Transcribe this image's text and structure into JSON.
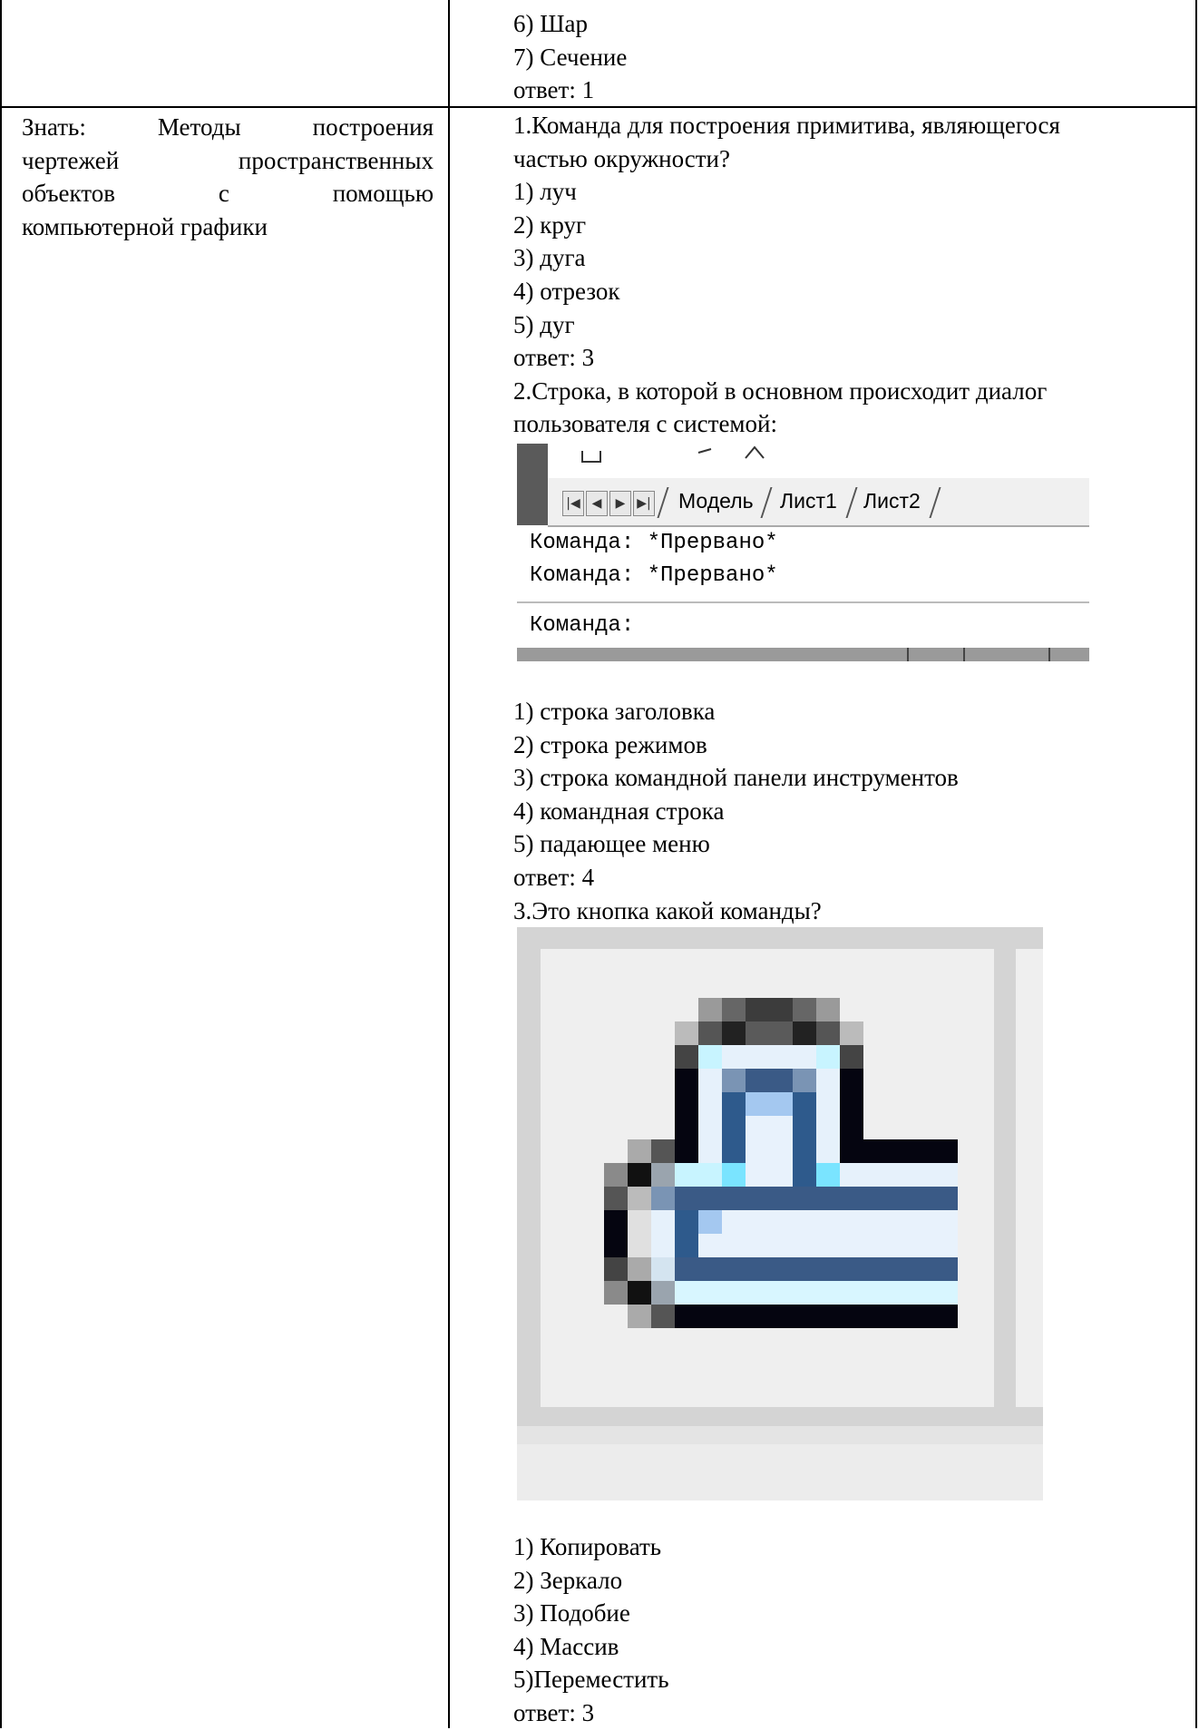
{
  "left_cell": {
    "lines": [
      "Знать: Методы построения",
      "чертежей пространственных",
      "объектов с помощью",
      "компьютерной графики"
    ],
    "words": [
      [
        "Знать:",
        "Методы",
        "построения"
      ],
      [
        "чертежей",
        "пространственных"
      ],
      [
        "объектов",
        "с",
        "помощью"
      ],
      [
        "компьютерной графики"
      ]
    ]
  },
  "top_cell": {
    "options": [
      "6) Шар",
      "7) Сечение"
    ],
    "answer": "ответ: 1"
  },
  "q1": {
    "title": "1.Команда для построения примитива, являющегося",
    "title_cont": "частью окружности?",
    "options": [
      "1) луч",
      "2) круг",
      "3) дуга",
      "4) отрезок",
      "5) дуг"
    ],
    "answer": "ответ: 3"
  },
  "q2": {
    "title": "2.Строка, в которой в основном происходит диалог",
    "title_cont": "пользователя с системой:",
    "screenshot": {
      "tabs": [
        "Модель",
        "Лист1",
        "Лист2"
      ],
      "nav_icons": [
        "first-icon",
        "prev-icon",
        "next-icon",
        "last-icon"
      ],
      "lines": [
        "Команда:  *Прервано*",
        "Команда:  *Прервано*",
        "Команда:"
      ]
    },
    "options": [
      "1) строка заголовка",
      "2) строка режимов",
      "3) строка командной панели инструментов",
      "4) командная строка",
      "5) падающее меню"
    ],
    "answer": "ответ: 4"
  },
  "q3": {
    "title": "3.Это кнопка какой команды?",
    "icon": "offset-command-icon",
    "options": [
      "1) Копировать",
      "2) Зеркало",
      "3) Подобие",
      "4) Массив",
      "5)Переместить"
    ],
    "answer": "ответ: 3"
  }
}
